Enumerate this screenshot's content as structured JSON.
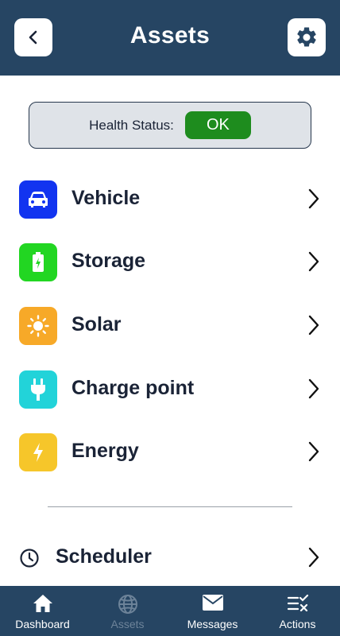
{
  "header": {
    "title": "Assets",
    "back_icon": "chevron-left-icon",
    "settings_icon": "gear-icon"
  },
  "health": {
    "label": "Health Status:",
    "status": "OK",
    "status_color": "#1e8c1e"
  },
  "assets": [
    {
      "label": "Vehicle",
      "icon": "car-icon",
      "color": "#1234f0"
    },
    {
      "label": "Storage",
      "icon": "battery-icon",
      "color": "#22d622"
    },
    {
      "label": "Solar",
      "icon": "sun-icon",
      "color": "#f7a928"
    },
    {
      "label": "Charge point",
      "icon": "plug-icon",
      "color": "#22d3d9"
    },
    {
      "label": "Energy",
      "icon": "lightning-icon",
      "color": "#f6c62a"
    }
  ],
  "scheduler": {
    "label": "Scheduler",
    "icon": "clock-icon"
  },
  "tabbar": {
    "tabs": [
      {
        "label": "Dashboard",
        "icon": "home-icon",
        "active": true
      },
      {
        "label": "Assets",
        "icon": "globe-icon",
        "active": false
      },
      {
        "label": "Messages",
        "icon": "envelope-icon",
        "active": true
      },
      {
        "label": "Actions",
        "icon": "checklist-icon",
        "active": true
      }
    ]
  },
  "colors": {
    "header_bg": "#264563",
    "text": "#1a2336"
  }
}
